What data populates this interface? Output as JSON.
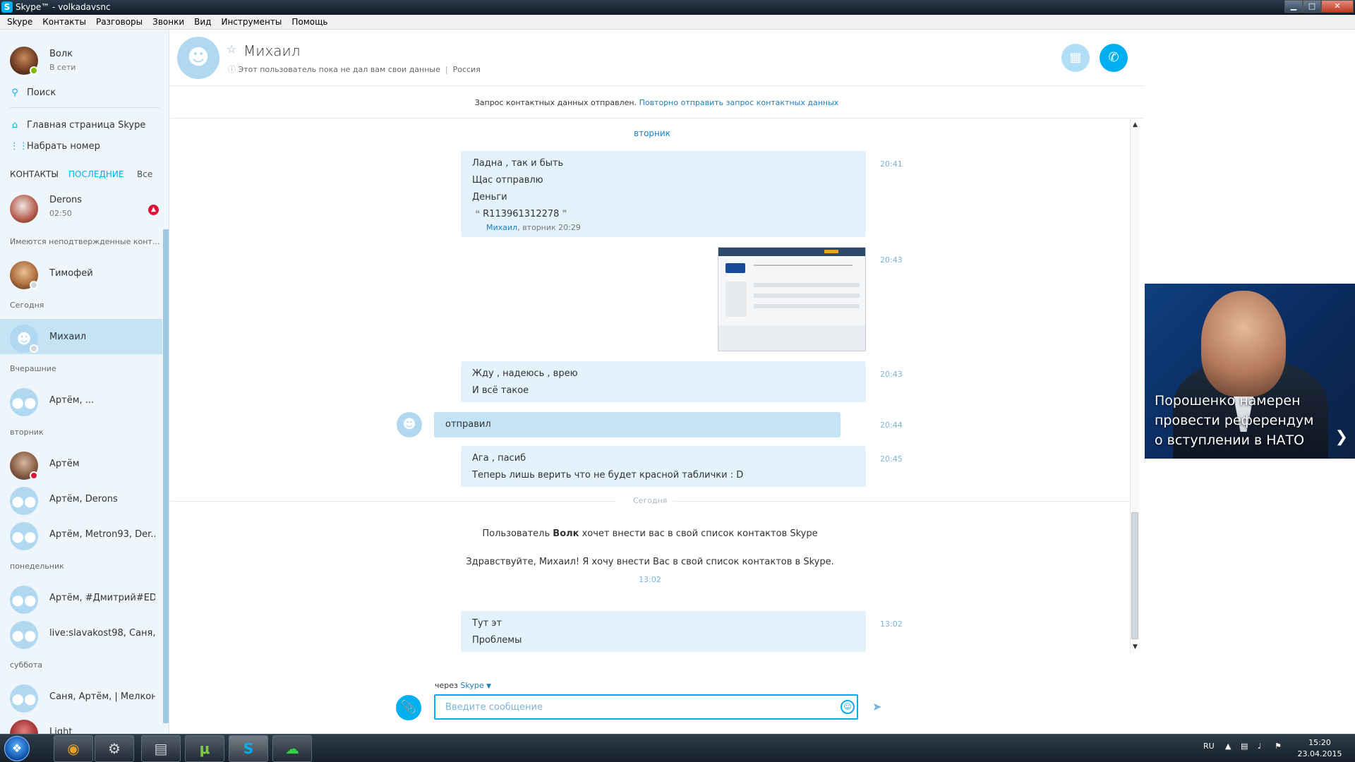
{
  "window": {
    "title": "Skype™ - volkadavsnc",
    "logo": "S",
    "minimize": "▁",
    "maximize": "□",
    "close": "✕"
  },
  "menu": [
    "Skype",
    "Контакты",
    "Разговоры",
    "Звонки",
    "Вид",
    "Инструменты",
    "Помощь"
  ],
  "profile": {
    "name": "Волк",
    "status": "В сети"
  },
  "sidebar": {
    "search": "Поиск",
    "home": "Главная страница Skype",
    "dial": "Набрать номер",
    "tabs": {
      "contacts": "КОНТАКТЫ",
      "recent": "ПОСЛЕДНИЕ",
      "filter": "Все"
    },
    "sections": {
      "pending": "Имеются неподтвержденные конт...",
      "today": "Сегодня",
      "yesterday": "Вчерашние",
      "tuesday": "вторник",
      "monday": "понедельник",
      "saturday": "суббота"
    },
    "contacts": {
      "derons": {
        "name": "Derons",
        "time": "02:50"
      },
      "timofey": {
        "name": "Тимофей"
      },
      "mikhail": {
        "name": "Михаил"
      },
      "artem_group": {
        "name": "Артём, ..."
      },
      "artem": {
        "name": "Артём"
      },
      "artem_derons": {
        "name": "Артём, Derons"
      },
      "artem_metron": {
        "name": "Артём, Metron93, Der..."
      },
      "artem_dmitry": {
        "name": "Артём, #Дмитрий#ED..."
      },
      "live_slava": {
        "name": "live:slavakost98, Саня,..."
      },
      "sanya_artem": {
        "name": "Саня, Артём, | Мелкон..."
      },
      "light": {
        "name": "Light"
      }
    }
  },
  "header": {
    "name": "Михаил",
    "info": "Этот пользователь пока не дал вам свои данные",
    "country": "Россия"
  },
  "notice": {
    "text": "Запрос контактных данных отправлен.",
    "link": "Повторно отправить запрос контактных данных"
  },
  "chat": {
    "day_tuesday": "вторник",
    "msg1": {
      "lines": [
        "Ладна , так и быть",
        "Щас отправлю",
        "Деньги"
      ],
      "quote": "R113961312278",
      "quote_author": "Михаил",
      "quote_time": "вторник 20:29",
      "time": "20:41"
    },
    "img_time": "20:43",
    "msg2": {
      "lines": [
        "Жду , надеюсь , врею",
        "И всё такое"
      ],
      "time": "20:43"
    },
    "msg3": {
      "text": "отправил",
      "time": "20:44"
    },
    "msg4": {
      "lines": [
        "Ага , пасиб",
        "Теперь лишь верить что не будет красной таблички : D"
      ],
      "time": "20:45"
    },
    "day_today": "Сегодня",
    "sys": {
      "prefix": "Пользователь",
      "user": "Волк",
      "suffix": "хочет внести вас в свой список контактов Skype",
      "greeting": "Здравствуйте, Михаил! Я хочу внести Вас в свой список контактов в Skype.",
      "time": "13:02"
    },
    "msg5": {
      "lines": [
        "Тут эт",
        "Проблемы"
      ],
      "time": "13:02"
    }
  },
  "compose": {
    "via": "через",
    "via_service": "Skype",
    "placeholder": "Введите сообщение"
  },
  "ad": {
    "text": "Порошенко намерен провести референдум о вступлении в НАТО"
  },
  "taskbar": {
    "lang": "RU",
    "time": "15:20",
    "date": "23.04.2015"
  },
  "icons": [
    "skype-logo-icon",
    "search-icon",
    "home-icon",
    "dialpad-icon",
    "chevron-down-icon",
    "user-icon",
    "group-icon",
    "star-icon",
    "help-icon",
    "video-call-icon",
    "phone-icon",
    "paperclip-icon",
    "smiley-icon",
    "send-icon",
    "windows-start-icon"
  ],
  "colors": {
    "accent": "#00aff0",
    "bubble": "#e3f2fb",
    "selected": "#c4e4f6",
    "sidebar": "#eef6fb",
    "online": "#7fba00",
    "busy": "#e0123a"
  }
}
